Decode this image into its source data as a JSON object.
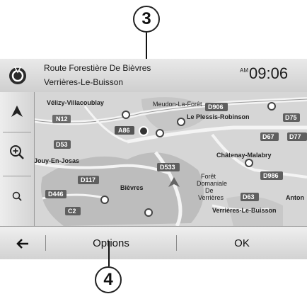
{
  "callouts": {
    "top": "3",
    "bottom": "4"
  },
  "header": {
    "street": "Route Forestière De Bièvres",
    "city": "Verrières-Le-Buisson",
    "clock_ampm": "AM",
    "clock": "09:06"
  },
  "map": {
    "places": [
      "Vélizy-Villacoublay",
      "Meudon-La-Forêt",
      "Le Plessis-Robinson",
      "Châtenay-Malabry",
      "Jouy-En-Josas",
      "Bièvres",
      "Forêt",
      "Domaniale",
      "De",
      "Verrières",
      "Verrières-Le-Buisson",
      "Anton"
    ],
    "roads": [
      "N12",
      "A86",
      "D906",
      "D75",
      "D67",
      "D77",
      "D53",
      "D533",
      "D117",
      "D446",
      "D986",
      "D63",
      "C2"
    ]
  },
  "sidebar": {
    "icons": [
      "north-arrow-icon",
      "zoom-in-icon",
      "zoom-out-icon"
    ]
  },
  "footer": {
    "back_icon": "back-arrow-icon",
    "options_label": "Options",
    "ok_label": "OK"
  }
}
